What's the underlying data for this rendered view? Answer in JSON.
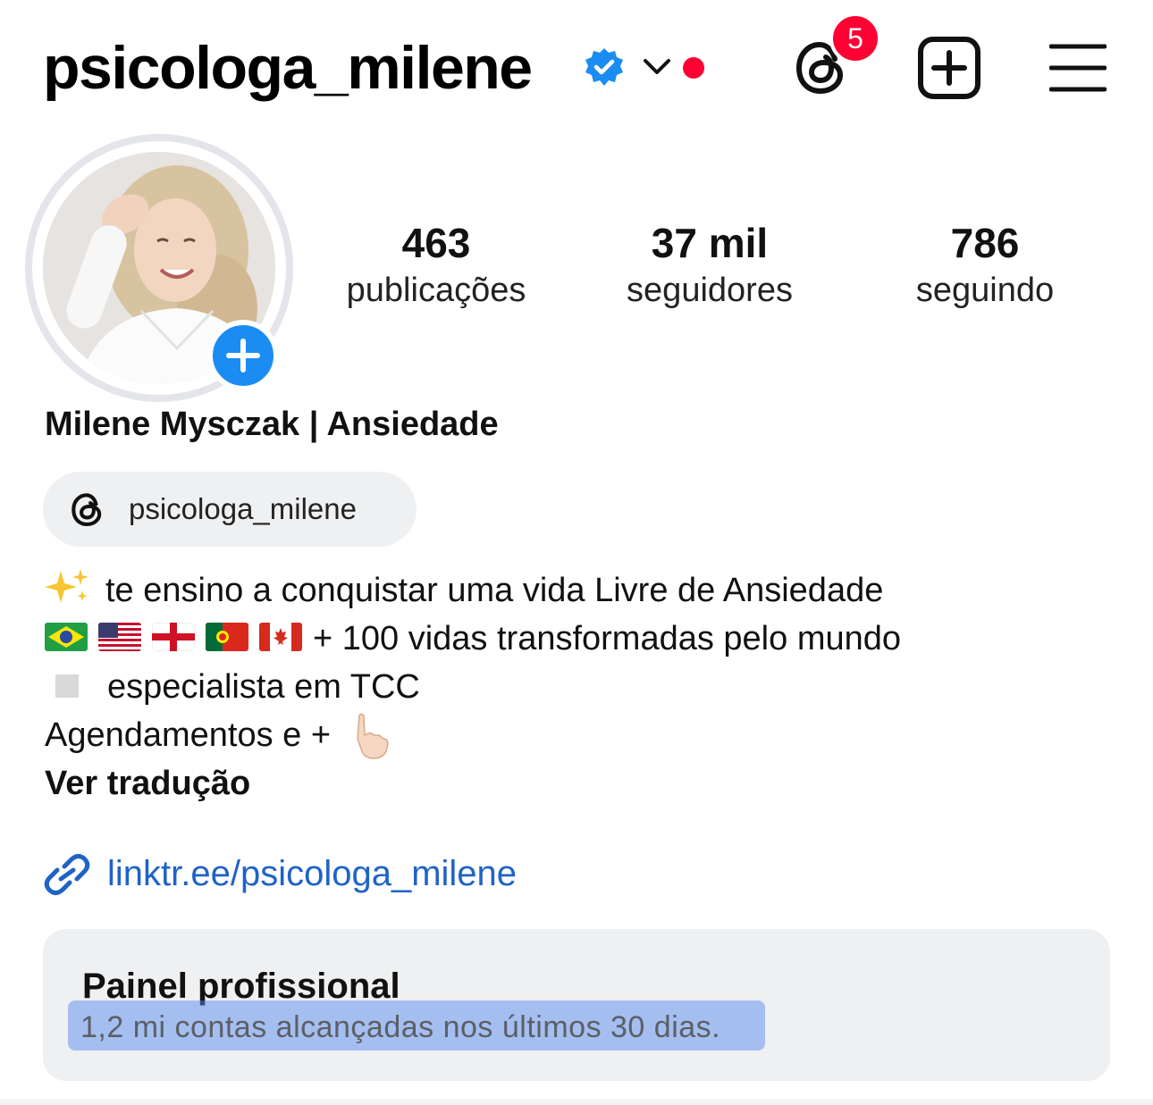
{
  "header": {
    "username": "psicologa_milene",
    "notification_count": "5",
    "icons": [
      "verified-badge-icon",
      "chevron-down-icon",
      "threads-icon",
      "new-post-icon",
      "menu-icon"
    ]
  },
  "profile": {
    "stats": {
      "posts_value": "463",
      "posts_label": "publicações",
      "followers_value": "37 mil",
      "followers_label": "seguidores",
      "following_value": "786",
      "following_label": "seguindo"
    },
    "full_name": "Milene Mysczak | Ansiedade",
    "threads_handle": "psicologa_milene",
    "bio": {
      "line1": "te ensino a conquistar uma vida Livre de Ansiedade",
      "line2": "+ 100 vidas transformadas pelo mundo",
      "line3": "especialista em TCC",
      "line4": "Agendamentos e +",
      "translate": "Ver tradução"
    },
    "link": "linktr.ee/psicologa_milene"
  },
  "pro_dashboard": {
    "title": "Painel profissional",
    "subtitle": "1,2 mi contas alcançadas nos últimos 30 dias."
  },
  "colors": {
    "accent_blue": "#1b8cf2",
    "link_blue": "#1f63c7",
    "notification_red": "#ff0033",
    "panel_bg": "#eff0f2"
  }
}
